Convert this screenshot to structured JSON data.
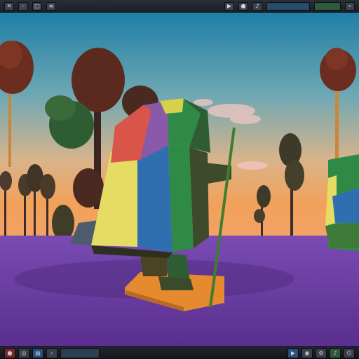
{
  "window": {
    "title_icons": [
      "close-icon",
      "minimize-icon",
      "maximize-icon",
      "menu-icon"
    ],
    "status_icons": [
      "play-icon",
      "record-icon",
      "audio-icon",
      "network-icon",
      "clock-icon"
    ]
  },
  "taskbar": {
    "left_icons": [
      "start-icon",
      "browser-icon",
      "files-icon",
      "terminal-icon"
    ],
    "right_icons": [
      "render-icon",
      "camera-icon",
      "settings-icon",
      "volume-icon",
      "power-icon"
    ]
  },
  "scene": {
    "subject": "low-poly-hiker",
    "colors": {
      "sky_top": "#1f7fa6",
      "sky_mid": "#8fb3b0",
      "sky_horizon": "#f2a15a",
      "ground": "#6b3fa0",
      "ground_dark": "#4c2a7a",
      "tree_canopy": "#5a2a1e",
      "tree_leaf": "#2f5d33",
      "block_yellow": "#e6dc63",
      "block_blue": "#2f6fb0",
      "block_green": "#2f8a46",
      "block_red": "#d9554a",
      "base_orange": "#e58a2e"
    }
  }
}
